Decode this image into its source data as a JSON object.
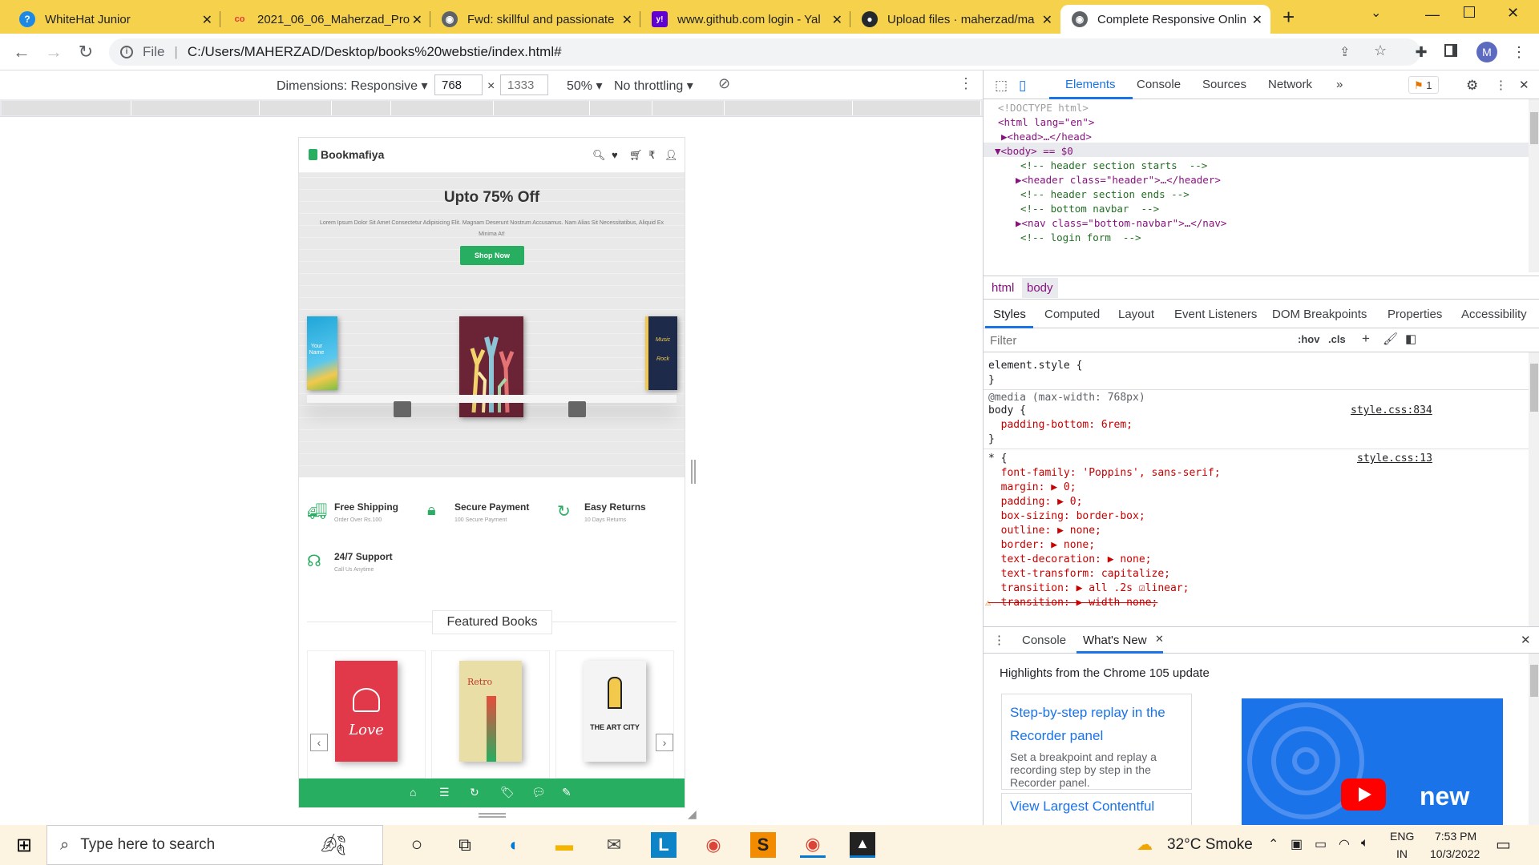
{
  "tabs": [
    {
      "title": "WhiteHat Junior",
      "fav_color": "#1e88e5",
      "fav_glyph": "?"
    },
    {
      "title": "2021_06_06_Maherzad_Proj",
      "fav_color": "#e53935",
      "fav_glyph": "co"
    },
    {
      "title": "Fwd: skillful and passionate",
      "fav_color": "#5f6368",
      "fav_glyph": "◉"
    },
    {
      "title": "www.github.com login - Yal",
      "fav_color": "#6001d2",
      "fav_glyph": "y!"
    },
    {
      "title": "Upload files · maherzad/ma",
      "fav_color": "#24292e",
      "fav_glyph": "●"
    },
    {
      "title": "Complete Responsive Onlin",
      "fav_color": "#5f6368",
      "fav_glyph": "◉"
    }
  ],
  "new_tab": "+",
  "address": {
    "scheme": "File",
    "url": "C:/Users/MAHERZAD/Desktop/books%20webstie/index.html#"
  },
  "profile_initial": "M",
  "device_toolbar": {
    "dimensions_label": "Dimensions: Responsive ▾",
    "width": "768",
    "times": "×",
    "height_placeholder": "1333",
    "zoom": "50% ▾",
    "throttle": "No throttling ▾"
  },
  "site": {
    "logo": "Bookmafiya",
    "hero_title": "Upto 75% Off",
    "hero_text": "Lorem Ipsum Dolor Sit Amet Consectetur Adipisicing Elit. Magnam Deserunt Nostrum Accusamus. Nam Alias Sit Necessitatibus, Aliquid Ex Minima At!",
    "shop_button": "Shop Now",
    "book_left_text": "Your Name",
    "book_right_text": "Music Rock",
    "features": [
      {
        "title": "Free Shipping",
        "sub": "Order Over Rs.100",
        "icon": "truck-icon"
      },
      {
        "title": "Secure Payment",
        "sub": "100 Secure Payment",
        "icon": "lock-icon"
      },
      {
        "title": "Easy Returns",
        "sub": "10 Days Returns",
        "icon": "redo-icon"
      },
      {
        "title": "24/7 Support",
        "sub": "Call Us Anytime",
        "icon": "headset-icon"
      }
    ],
    "featured_title": "Featured Books",
    "featured_covers": [
      {
        "text": "Love",
        "bg": "#e2394a"
      },
      {
        "text": "Retro",
        "bg": "#e9dfa6"
      },
      {
        "text": "THE ART CITY",
        "bg": "#f4f4f4"
      }
    ],
    "accent": "#27ae60"
  },
  "devtools": {
    "tabs": [
      "Elements",
      "Console",
      "Sources",
      "Network",
      "»"
    ],
    "issues": "1",
    "dom_lines": [
      "<!DOCTYPE html>",
      "<html lang=\"en\">",
      "▶<head>…</head>",
      "▼<body> == $0",
      "<!-- header section starts  -->",
      "▶<header class=\"header\">…</header>",
      "<!-- header section ends -->",
      "<!-- bottom navbar  -->",
      "▶<nav class=\"bottom-navbar\">…</nav>",
      "<!-- login form  -->"
    ],
    "breadcrumbs": [
      "html",
      "body"
    ],
    "style_tabs": [
      "Styles",
      "Computed",
      "Layout",
      "Event Listeners",
      "DOM Breakpoints",
      "Properties",
      "Accessibility"
    ],
    "filter_placeholder": "Filter",
    "filter_tools": [
      ":hov",
      ".cls",
      "+"
    ],
    "css": [
      "element.style {",
      "}",
      "@media (max-width: 768px)",
      "body {",
      "  padding-bottom: 6rem;",
      "}",
      "* {",
      "  font-family: 'Poppins', sans-serif;",
      "  margin: ▶ 0;",
      "  padding: ▶ 0;",
      "  box-sizing: border-box;",
      "  outline: ▶ none;",
      "  border: ▶ none;",
      "  text-decoration: ▶ none;",
      "  text-transform: capitalize;",
      "  transition: ▶ all .2s ☑linear;",
      "  transition: ▶ width none;"
    ],
    "css_sources": [
      "style.css:834",
      "style.css:13"
    ],
    "drawer_tabs": [
      "Console",
      "What's New"
    ],
    "drawer_heading": "Highlights from the Chrome 105 update",
    "card1_title": "Step-by-step replay in the Recorder panel",
    "card1_text": "Set a breakpoint and replay a recording step by step in the Recorder panel.",
    "card2_title": "View Largest Contentful",
    "video_badge": "new"
  },
  "taskbar": {
    "search_placeholder": "Type here to search",
    "weather": "32°C  Smoke",
    "lang1": "ENG",
    "lang2": "IN",
    "time": "7:53 PM",
    "date": "10/3/2022"
  }
}
